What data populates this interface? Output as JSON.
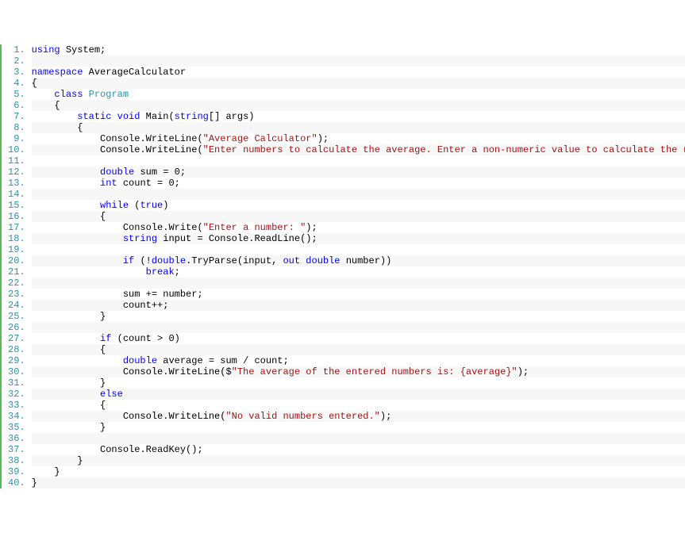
{
  "code": {
    "lines": [
      {
        "indent": 0,
        "tokens": [
          {
            "t": "using ",
            "c": "kw"
          },
          {
            "t": "System;",
            "c": "plain"
          }
        ]
      },
      {
        "indent": 0,
        "tokens": []
      },
      {
        "indent": 0,
        "tokens": [
          {
            "t": "namespace ",
            "c": "kw"
          },
          {
            "t": "AverageCalculator",
            "c": "plain"
          }
        ]
      },
      {
        "indent": 0,
        "tokens": [
          {
            "t": "{",
            "c": "plain"
          }
        ]
      },
      {
        "indent": 1,
        "tokens": [
          {
            "t": "class ",
            "c": "kw"
          },
          {
            "t": "Program",
            "c": "type"
          }
        ]
      },
      {
        "indent": 1,
        "tokens": [
          {
            "t": "{",
            "c": "plain"
          }
        ]
      },
      {
        "indent": 2,
        "tokens": [
          {
            "t": "static void ",
            "c": "kw"
          },
          {
            "t": "Main(",
            "c": "plain"
          },
          {
            "t": "string",
            "c": "kw"
          },
          {
            "t": "[] args)",
            "c": "plain"
          }
        ]
      },
      {
        "indent": 2,
        "tokens": [
          {
            "t": "{",
            "c": "plain"
          }
        ]
      },
      {
        "indent": 3,
        "tokens": [
          {
            "t": "Console.WriteLine(",
            "c": "plain"
          },
          {
            "t": "\"Average Calculator\"",
            "c": "str"
          },
          {
            "t": ");",
            "c": "plain"
          }
        ]
      },
      {
        "indent": 3,
        "tokens": [
          {
            "t": "Console.WriteLine(",
            "c": "plain"
          },
          {
            "t": "\"Enter numbers to calculate the average. Enter a non-numeric value to calculate the result.\"",
            "c": "str"
          },
          {
            "t": ");",
            "c": "plain"
          }
        ]
      },
      {
        "indent": 0,
        "tokens": []
      },
      {
        "indent": 3,
        "tokens": [
          {
            "t": "double ",
            "c": "kw"
          },
          {
            "t": "sum = 0;",
            "c": "plain"
          }
        ]
      },
      {
        "indent": 3,
        "tokens": [
          {
            "t": "int ",
            "c": "kw"
          },
          {
            "t": "count = 0;",
            "c": "plain"
          }
        ]
      },
      {
        "indent": 0,
        "tokens": []
      },
      {
        "indent": 3,
        "tokens": [
          {
            "t": "while ",
            "c": "kw"
          },
          {
            "t": "(",
            "c": "plain"
          },
          {
            "t": "true",
            "c": "kw"
          },
          {
            "t": ")",
            "c": "plain"
          }
        ]
      },
      {
        "indent": 3,
        "tokens": [
          {
            "t": "{",
            "c": "plain"
          }
        ]
      },
      {
        "indent": 4,
        "tokens": [
          {
            "t": "Console.Write(",
            "c": "plain"
          },
          {
            "t": "\"Enter a number: \"",
            "c": "str"
          },
          {
            "t": ");",
            "c": "plain"
          }
        ]
      },
      {
        "indent": 4,
        "tokens": [
          {
            "t": "string ",
            "c": "kw"
          },
          {
            "t": "input = Console.ReadLine();",
            "c": "plain"
          }
        ]
      },
      {
        "indent": 0,
        "tokens": []
      },
      {
        "indent": 4,
        "tokens": [
          {
            "t": "if ",
            "c": "kw"
          },
          {
            "t": "(!",
            "c": "plain"
          },
          {
            "t": "double",
            "c": "kw"
          },
          {
            "t": ".TryParse(input, ",
            "c": "plain"
          },
          {
            "t": "out double ",
            "c": "kw"
          },
          {
            "t": "number))",
            "c": "plain"
          }
        ]
      },
      {
        "indent": 5,
        "tokens": [
          {
            "t": "break",
            "c": "kw"
          },
          {
            "t": ";",
            "c": "plain"
          }
        ]
      },
      {
        "indent": 0,
        "tokens": []
      },
      {
        "indent": 4,
        "tokens": [
          {
            "t": "sum += number;",
            "c": "plain"
          }
        ]
      },
      {
        "indent": 4,
        "tokens": [
          {
            "t": "count++;",
            "c": "plain"
          }
        ]
      },
      {
        "indent": 3,
        "tokens": [
          {
            "t": "}",
            "c": "plain"
          }
        ]
      },
      {
        "indent": 0,
        "tokens": []
      },
      {
        "indent": 3,
        "tokens": [
          {
            "t": "if ",
            "c": "kw"
          },
          {
            "t": "(count > 0)",
            "c": "plain"
          }
        ]
      },
      {
        "indent": 3,
        "tokens": [
          {
            "t": "{",
            "c": "plain"
          }
        ]
      },
      {
        "indent": 4,
        "tokens": [
          {
            "t": "double ",
            "c": "kw"
          },
          {
            "t": "average = sum / count;",
            "c": "plain"
          }
        ]
      },
      {
        "indent": 4,
        "tokens": [
          {
            "t": "Console.WriteLine($",
            "c": "plain"
          },
          {
            "t": "\"The average of the entered numbers is: {average}\"",
            "c": "str"
          },
          {
            "t": ");",
            "c": "plain"
          }
        ]
      },
      {
        "indent": 3,
        "tokens": [
          {
            "t": "}",
            "c": "plain"
          }
        ]
      },
      {
        "indent": 3,
        "tokens": [
          {
            "t": "else",
            "c": "kw"
          }
        ]
      },
      {
        "indent": 3,
        "tokens": [
          {
            "t": "{",
            "c": "plain"
          }
        ]
      },
      {
        "indent": 4,
        "tokens": [
          {
            "t": "Console.WriteLine(",
            "c": "plain"
          },
          {
            "t": "\"No valid numbers entered.\"",
            "c": "str"
          },
          {
            "t": ");",
            "c": "plain"
          }
        ]
      },
      {
        "indent": 3,
        "tokens": [
          {
            "t": "}",
            "c": "plain"
          }
        ]
      },
      {
        "indent": 0,
        "tokens": []
      },
      {
        "indent": 3,
        "tokens": [
          {
            "t": "Console.ReadKey();",
            "c": "plain"
          }
        ]
      },
      {
        "indent": 2,
        "tokens": [
          {
            "t": "}",
            "c": "plain"
          }
        ]
      },
      {
        "indent": 1,
        "tokens": [
          {
            "t": "}",
            "c": "plain"
          }
        ]
      },
      {
        "indent": 0,
        "tokens": [
          {
            "t": "}",
            "c": "plain"
          }
        ]
      }
    ]
  }
}
